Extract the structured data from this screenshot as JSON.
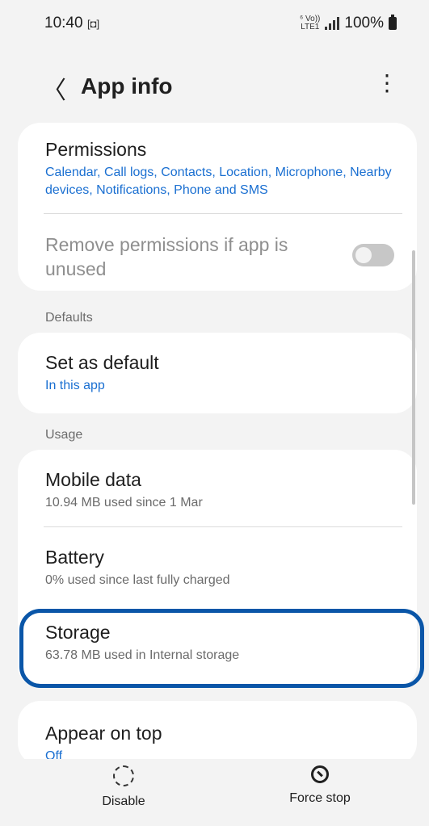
{
  "status_bar": {
    "time": "10:40",
    "screen_record_glyph": "[◘]",
    "network_top": "⁶ Vo))",
    "network_bottom": "LTE1",
    "battery": "100%"
  },
  "header": {
    "back_glyph": "〈",
    "title": "App info",
    "more_glyph": "⋮"
  },
  "permissions": {
    "title": "Permissions",
    "summary": "Calendar, Call logs, Contacts, Location, Microphone, Nearby devices, Notifications, Phone and SMS",
    "remove_unused_label": "Remove permissions if app is unused",
    "remove_unused_enabled": false
  },
  "defaults": {
    "section_label": "Defaults",
    "set_default_title": "Set as default",
    "set_default_sub": "In this app"
  },
  "usage": {
    "section_label": "Usage",
    "mobile_data_title": "Mobile data",
    "mobile_data_sub": "10.94 MB used since 1 Mar",
    "battery_title": "Battery",
    "battery_sub": "0% used since last fully charged",
    "storage_title": "Storage",
    "storage_sub": "63.78 MB used in Internal storage"
  },
  "appear_on_top": {
    "title": "Appear on top",
    "sub": "Off"
  },
  "bottom": {
    "disable_label": "Disable",
    "force_stop_label": "Force stop"
  },
  "colors": {
    "accent_link": "#1a6fd1",
    "highlight_border": "#0a56a8"
  }
}
